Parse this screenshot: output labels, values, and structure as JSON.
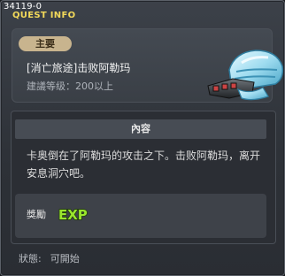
{
  "window": {
    "quest_id": "34119-0",
    "title": "QUEST INFO"
  },
  "quest": {
    "category_badge": "主要",
    "name": "[消亡旅途]击败阿勒玛",
    "level_requirement": "建議等级：200以上",
    "item_icon": "helmet-gauntlet-icon"
  },
  "content": {
    "header": "內容",
    "description": "卡奥倒在了阿勒玛的攻击之下。击败阿勒玛，离开安息洞穴吧。"
  },
  "reward": {
    "label": "獎勵",
    "icon": "exp-icon",
    "icon_text": "EXP"
  },
  "status": {
    "label": "狀態:",
    "value": "可開始"
  },
  "colors": {
    "title": "#f2d95a",
    "badge_bg": "#c8b48e",
    "exp_green": "#9ae62e"
  }
}
